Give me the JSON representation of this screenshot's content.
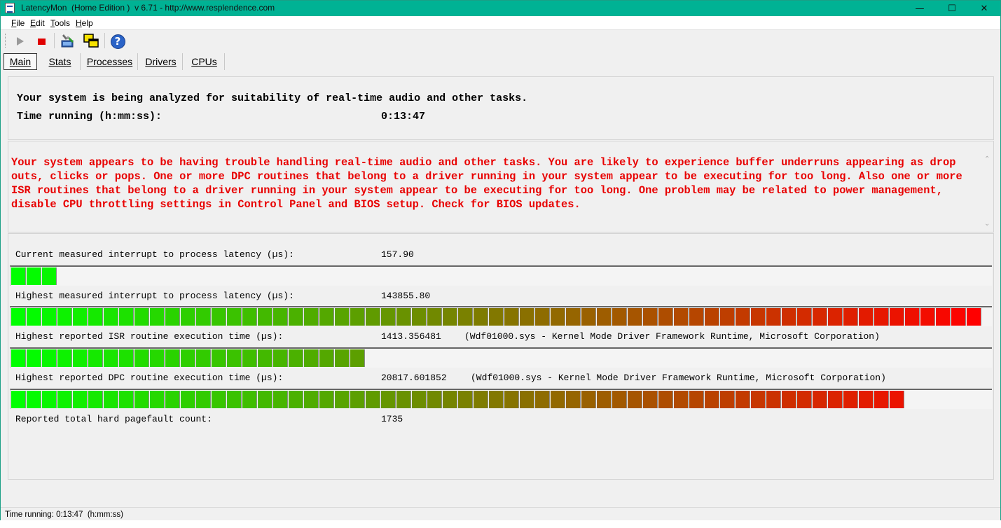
{
  "window": {
    "title": "LatencyMon  (Home Edition )  v 6.71 - http://www.resplendence.com",
    "minimize_glyph": "—",
    "maximize_glyph": "☐",
    "close_glyph": "✕"
  },
  "menu": [
    {
      "hot": "F",
      "rest": "ile"
    },
    {
      "hot": "E",
      "rest": "dit"
    },
    {
      "hot": "T",
      "rest": "ools"
    },
    {
      "hot": "H",
      "rest": "elp"
    }
  ],
  "toolbar": {
    "icons": [
      "play-icon",
      "stop-icon",
      "pc-tools-icon",
      "windows-icon",
      "help-icon"
    ],
    "help_glyph": "?"
  },
  "tabs": [
    {
      "label": "Main",
      "selected": true
    },
    {
      "label": "Stats",
      "selected": false
    },
    {
      "label": "Processes",
      "selected": false
    },
    {
      "label": "Drivers",
      "selected": false
    },
    {
      "label": "CPUs",
      "selected": false
    }
  ],
  "status": {
    "heading": "Your system is being analyzed for suitability of real-time audio and other tasks.",
    "time_label": "Time running (h:mm:ss):",
    "time_value": "0:13:47"
  },
  "message": {
    "text": "Your system appears to be having trouble handling real-time audio and other tasks. You are likely to experience buffer underruns appearing as drop outs, clicks or pops. One or more DPC routines that belong to a driver running in your system appear to be executing for too long. Also one or more ISR routines that belong to a driver running in your system appear to be executing for too long. One problem may be related to power management, disable CPU throttling settings in Control Panel and BIOS setup. Check for BIOS updates.",
    "color": "#e80000",
    "scroll_up": "⌃",
    "scroll_down": "⌄"
  },
  "meters": {
    "current_latency": {
      "label": "Current measured interrupt to process latency (µs):",
      "value": "157.90",
      "level": 0.043
    },
    "highest_latency": {
      "label": "Highest measured interrupt to process latency (µs):",
      "value": "143855.80",
      "level": 1.0
    },
    "isr": {
      "label": "Highest reported ISR routine execution time (µs):",
      "value": "1413.356481",
      "detail": "(Wdf01000.sys - Kernel Mode Driver Framework Runtime, Microsoft Corporation)",
      "level": 0.359
    },
    "dpc": {
      "label": "Highest reported DPC routine execution time (µs):",
      "value": "20817.601852",
      "detail": "(Wdf01000.sys - Kernel Mode Driver Framework Runtime, Microsoft Corporation)",
      "level": 0.924
    },
    "pagefault": {
      "label": "Reported total hard pagefault count:",
      "value": "1735"
    }
  },
  "statusbar": {
    "text": "Time running: 0:13:47  (h:mm:ss)"
  },
  "colors": {
    "titlebar": "#00b294",
    "bar_start": "#00ff00",
    "bar_end": "#ff0000"
  }
}
